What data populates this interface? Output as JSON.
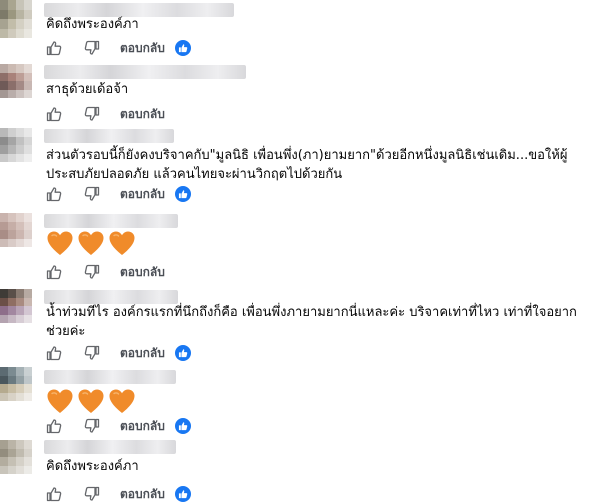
{
  "comments": [
    {
      "text": "คิดถึงพระองค์ภา",
      "reply_label": "ตอบกลับ",
      "reaction": "like-badge"
    },
    {
      "text": "สาธุด้วยเด้อจ้า",
      "reply_label": "ตอบกลับ",
      "reaction": ""
    },
    {
      "text_line1": "ส่วนตัวรอบนี้ก็ยังคงบริจาคกับ\"มูลนิธิ เพื่อนพึ่ง(ภา)ยามยาก\"ด้วยอีกหนึ่งมูลนิธิเช่นเดิม...ขอให้ผู้",
      "text_line2": "ประสบภัยปลอดภัย แล้วคนไทยจะผ่านวิกฤตไปด้วยกัน",
      "reaction": "like-badge"
    },
    {
      "emoji": "orange-heart x3",
      "reply_label": "ตอบกลับ",
      "reaction": ""
    },
    {
      "text_line1": "น้ำท่วมทีไร องค์กรแรกที่นึกถึงก็คือ เพื่อนพึ่งภายามยากนี่แหละค่ะ บริจาคเท่าที่ไหว เท่าที่ใจอยาก",
      "text_line2": "ช่วยค่ะ",
      "reply_label": "ตอบกลับ",
      "reaction": "like-badge"
    },
    {
      "emoji": "orange-heart x3",
      "reply_label": "ตอบกลับ",
      "reaction": "like-badge"
    },
    {
      "text": "คิดถึงพระองค์ภา",
      "reply_label": "ตอบกลับ",
      "reaction": "like-badge"
    }
  ],
  "colors": {
    "accent": "#1877f2",
    "heart": "#f08b2a",
    "icon": "#65676b"
  },
  "icons": {
    "like": "thumbs-up-icon",
    "dislike": "thumbs-down-icon",
    "reaction": "like-reaction-badge"
  }
}
